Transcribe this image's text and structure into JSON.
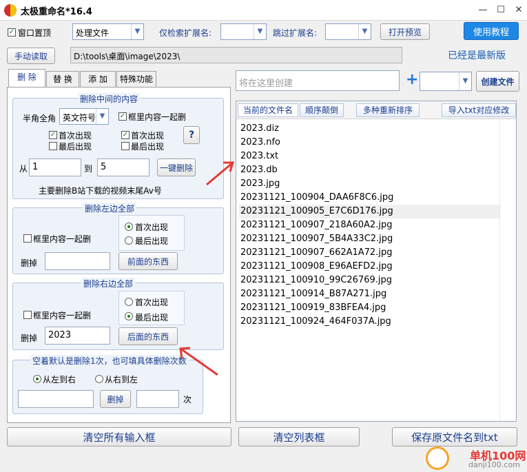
{
  "window": {
    "title": "太极重命名*16.4",
    "min": "—",
    "max": "☐",
    "close": "✕"
  },
  "toolbar": {
    "topmost_label": "窗口置顶",
    "mode_combo": "处理文件",
    "only_ext_label": "仅检索扩展名:",
    "skip_ext_label": "跳过扩展名:",
    "open_preview": "打开预览",
    "tutorial": "使用教程",
    "manual_read": "手动读取",
    "path": "D:\\tools\\桌面\\image\\2023\\",
    "update_status": "已经是最新版"
  },
  "tabs": [
    "删 除",
    "替 换",
    "添 加",
    "特殊功能"
  ],
  "middle_group": {
    "title": "删除中间的内容",
    "halfwidth_label": "半角全角",
    "halfwidth_value": "英文符号",
    "inbox_label": "框里内容一起删",
    "first1": "首次出现",
    "last1": "最后出现",
    "first2": "首次出现",
    "last2": "最后出现",
    "help": "?",
    "from_label": "从",
    "from_value": "1",
    "to_label": "到",
    "to_value": "5",
    "one_click": "一键删除",
    "hint": "主要删除B站下载的视频末尾Av号"
  },
  "left_group": {
    "title": "删除左边全部",
    "inbox_label": "框里内容一起删",
    "first": "首次出现",
    "last": "最后出现",
    "delete_label": "删掉",
    "delete_value": "",
    "button": "前面的东西"
  },
  "right_group": {
    "title": "删除右边全部",
    "inbox_label": "框里内容一起删",
    "first": "首次出现",
    "last": "最后出现",
    "delete_label": "删掉",
    "delete_value": "2023",
    "button": "后面的东西"
  },
  "count_group": {
    "title": "空着默认是删除1次，也可填具体删除次数",
    "ltr": "从左到右",
    "rtl": "从右到左",
    "delete_button": "删掉",
    "times_label": "次"
  },
  "create": {
    "placeholder": "将在这里创建",
    "plus": "+",
    "button": "创建文件"
  },
  "list": {
    "headers": [
      "当前的文件名",
      "顺序颠倒",
      "多种重新排序",
      "导入txt对应修改"
    ],
    "items": [
      "2023.diz",
      "2023.nfo",
      "2023.txt",
      "2023.db",
      "2023.jpg",
      "20231121_100904_DAA6F8C6.jpg",
      "20231121_100905_E7C6D176.jpg",
      "20231121_100907_218A60A2.jpg",
      "20231121_100907_5B4A33C2.jpg",
      "20231121_100907_662A1A72.jpg",
      "20231121_100908_E96AEFD2.jpg",
      "20231121_100910_99C26769.jpg",
      "20231121_100914_B87A271.jpg",
      "20231121_100919_83BFEA4.jpg",
      "20231121_100924_464F037A.jpg"
    ]
  },
  "bottom": {
    "clear_inputs": "清空所有输入框",
    "clear_list": "清空列表框",
    "save_names": "保存原文件名到txt"
  },
  "watermark": {
    "brand": "单机100网",
    "url": "danji100.com"
  },
  "colors": {
    "accent": "#1e88e5",
    "link": "#1a3d8f",
    "arrow": "#e53935"
  }
}
